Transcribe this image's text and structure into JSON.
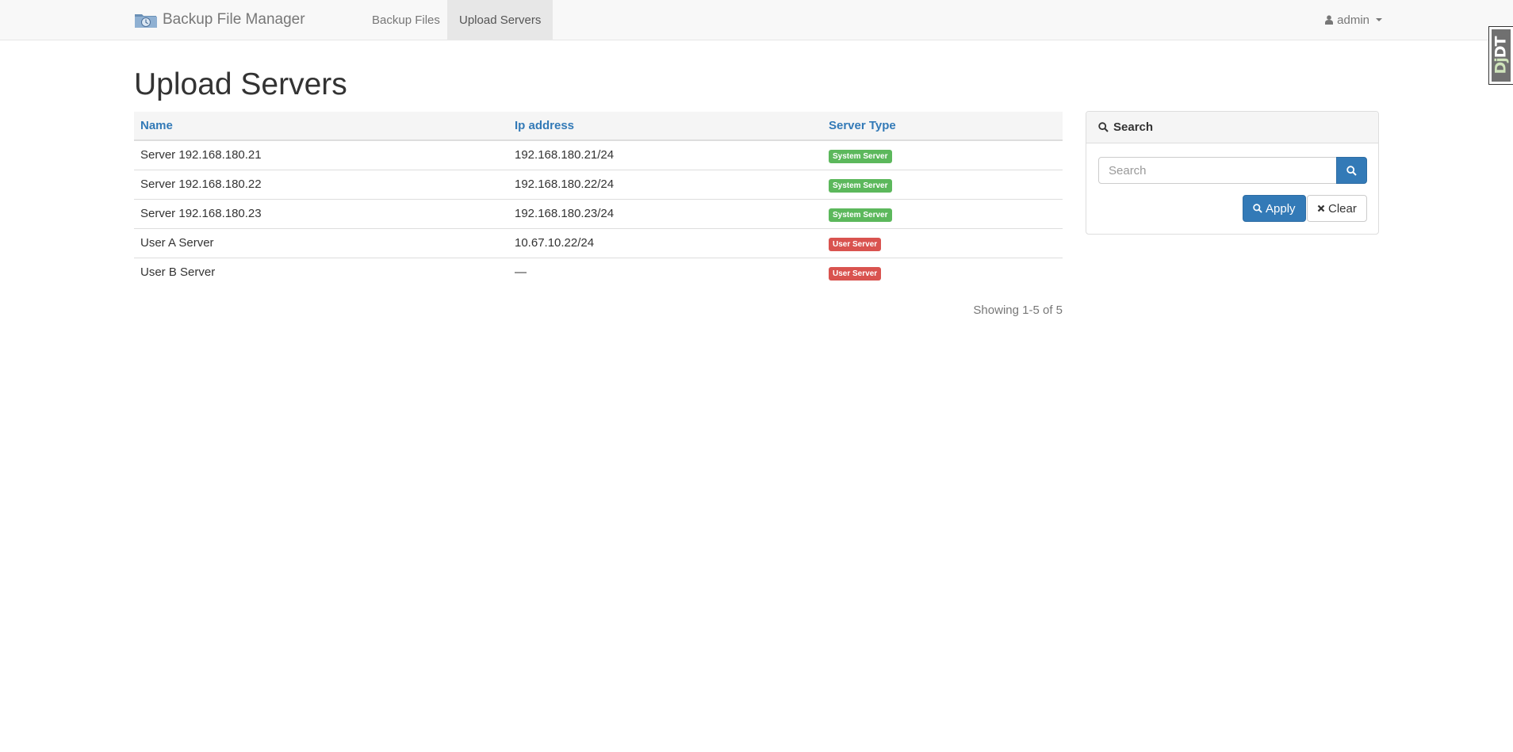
{
  "navbar": {
    "brand": "Backup File Manager",
    "items": [
      {
        "label": "Backup Files",
        "active": false
      },
      {
        "label": "Upload Servers",
        "active": true
      }
    ],
    "user": "admin"
  },
  "page": {
    "title": "Upload Servers"
  },
  "table": {
    "columns": [
      "Name",
      "Ip address",
      "Server Type"
    ],
    "rows": [
      {
        "name": "Server 192.168.180.21",
        "ip": "192.168.180.21/24",
        "type": "System Server",
        "type_color": "#5cb85c"
      },
      {
        "name": "Server 192.168.180.22",
        "ip": "192.168.180.22/24",
        "type": "System Server",
        "type_color": "#5cb85c"
      },
      {
        "name": "Server 192.168.180.23",
        "ip": "192.168.180.23/24",
        "type": "System Server",
        "type_color": "#5cb85c"
      },
      {
        "name": "User A Server",
        "ip": "10.67.10.22/24",
        "type": "User Server",
        "type_color": "#d9534f"
      },
      {
        "name": "User B Server",
        "ip": "—",
        "type": "User Server",
        "type_color": "#d9534f"
      }
    ],
    "summary": "Showing 1-5 of 5"
  },
  "search_panel": {
    "title": "Search",
    "placeholder": "Search",
    "value": "",
    "apply_label": "Apply",
    "clear_label": "Clear"
  },
  "debug_toolbar": {
    "label_dj": "Dj",
    "label_dt": "DT"
  },
  "colors": {
    "link": "#337ab7",
    "primary": "#337ab7",
    "success": "#5cb85c",
    "danger": "#d9534f"
  },
  "icons": {
    "brand": "folder-clock-icon",
    "user": "user-icon",
    "search": "search-icon",
    "clear": "close-icon"
  }
}
